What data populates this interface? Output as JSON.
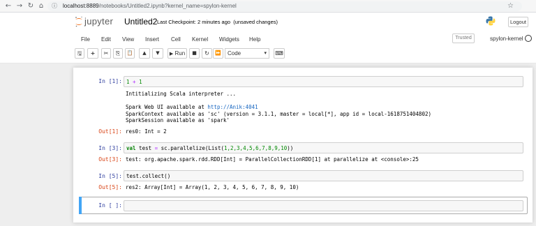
{
  "browser": {
    "back": "←",
    "forward": "→",
    "reload": "↻",
    "home": "⌂",
    "lock": "ⓘ",
    "url_host": "localhost:8889",
    "url_path": "/notebooks/Untitled2.ipynb?kernel_name=spylon-kernel",
    "star": "☆"
  },
  "header": {
    "logo_text": "jupyter",
    "notebook_title": "Untitled2",
    "checkpoint": "Last Checkpoint: 2 minutes ago",
    "unsaved": "(unsaved changes)",
    "logout": "Logout"
  },
  "menu": {
    "items": [
      "File",
      "Edit",
      "View",
      "Insert",
      "Cell",
      "Kernel",
      "Widgets",
      "Help"
    ],
    "trusted": "Trusted",
    "kernel": "spylon-kernel"
  },
  "toolbar": {
    "save_icon": "🖫",
    "add_icon": "+",
    "cut_icon": "✂",
    "copy_icon": "⎘",
    "paste_icon": "📋",
    "up_icon": "▲",
    "down_icon": "▼",
    "run_icon": "▶",
    "run_label": "Run",
    "stop_icon": "■",
    "restart_icon": "↻",
    "fastforward_icon": "⏩",
    "cell_type": "Code",
    "dropdown_icon": "▾",
    "keyboard_icon": "⌨"
  },
  "cells": {
    "c1": {
      "in_prompt": "In [1]:",
      "code_a": "1",
      "code_op": " + ",
      "code_b": "1",
      "stream_line1": "Intitializing Scala interpreter ...",
      "stream_line2_prefix": "Spark Web UI available at ",
      "stream_link": "http://Anik:4041",
      "stream_line3": "SparkContext available as 'sc' (version = 3.1.1, master = local[*], app id = local-1618751404802)",
      "stream_line4": "SparkSession available as 'spark'",
      "out_prompt": "Out[1]:",
      "result": "res0: Int = 2"
    },
    "c2": {
      "in_prompt": "In [3]:",
      "code_kw": "val",
      "code_rest1": " test ",
      "code_eq": "=",
      "code_rest2": " sc.parallelize(List(",
      "code_nums": "1,2,3,4,5,6,7,8,9,10",
      "code_end": "))",
      "out_prompt": "Out[3]:",
      "result": "test: org.apache.spark.rdd.RDD[Int] = ParallelCollectionRDD[1] at parallelize at <console>:25"
    },
    "c3": {
      "in_prompt": "In [5]:",
      "code": "test.collect()",
      "out_prompt": "Out[5]:",
      "result": "res2: Array[Int] = Array(1, 2, 3, 4, 5, 6, 7, 8, 9, 10)"
    },
    "c4": {
      "in_prompt": "In [ ]:",
      "code": ""
    }
  }
}
